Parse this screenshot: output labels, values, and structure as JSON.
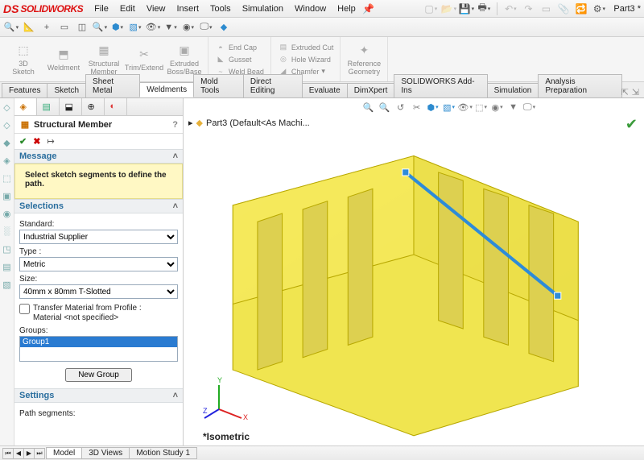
{
  "app": {
    "logo_mark": "DS",
    "logo_text": "SOLIDWORKS",
    "part_name": "Part3 *"
  },
  "menu": {
    "items": [
      "File",
      "Edit",
      "View",
      "Insert",
      "Tools",
      "Simulation",
      "Window",
      "Help"
    ]
  },
  "ribbon": {
    "large": [
      {
        "label": "3D\nSketch"
      },
      {
        "label": "Weldment"
      },
      {
        "label": "Structural\nMember"
      },
      {
        "label": "Trim/Extend"
      },
      {
        "label": "Extruded\nBoss/Base"
      }
    ],
    "stack1": [
      "End Cap",
      "Gusset",
      "Weld Bead"
    ],
    "stack2": [
      "Extruded Cut",
      "Hole Wizard",
      "Chamfer"
    ],
    "stack3_label": "Reference\nGeometry"
  },
  "tabs": {
    "items": [
      "Features",
      "Sketch",
      "Sheet Metal",
      "Weldments",
      "Mold Tools",
      "Direct Editing",
      "Evaluate",
      "DimXpert",
      "SOLIDWORKS Add-Ins",
      "Simulation",
      "Analysis Preparation"
    ],
    "active": 3
  },
  "panel": {
    "title": "Structural Member",
    "message_head": "Message",
    "message_body": "Select sketch segments to define the path.",
    "selections_head": "Selections",
    "standard_label": "Standard:",
    "standard_value": "Industrial Supplier",
    "type_label": "Type :",
    "type_value": "Metric",
    "size_label": "Size:",
    "size_value": "40mm x 80mm T-Slotted",
    "transfer_label": "Transfer Material from Profile :\nMaterial <not specified>",
    "groups_label": "Groups:",
    "group1": "Group1",
    "new_group": "New Group",
    "settings_head": "Settings",
    "path_segments_label": "Path segments:"
  },
  "viewport": {
    "breadcrumb": "Part3  (Default<As Machi...",
    "view_label": "*Isometric"
  },
  "statusbar": {
    "tabs": [
      "Model",
      "3D Views",
      "Motion Study 1"
    ],
    "active": 0
  }
}
